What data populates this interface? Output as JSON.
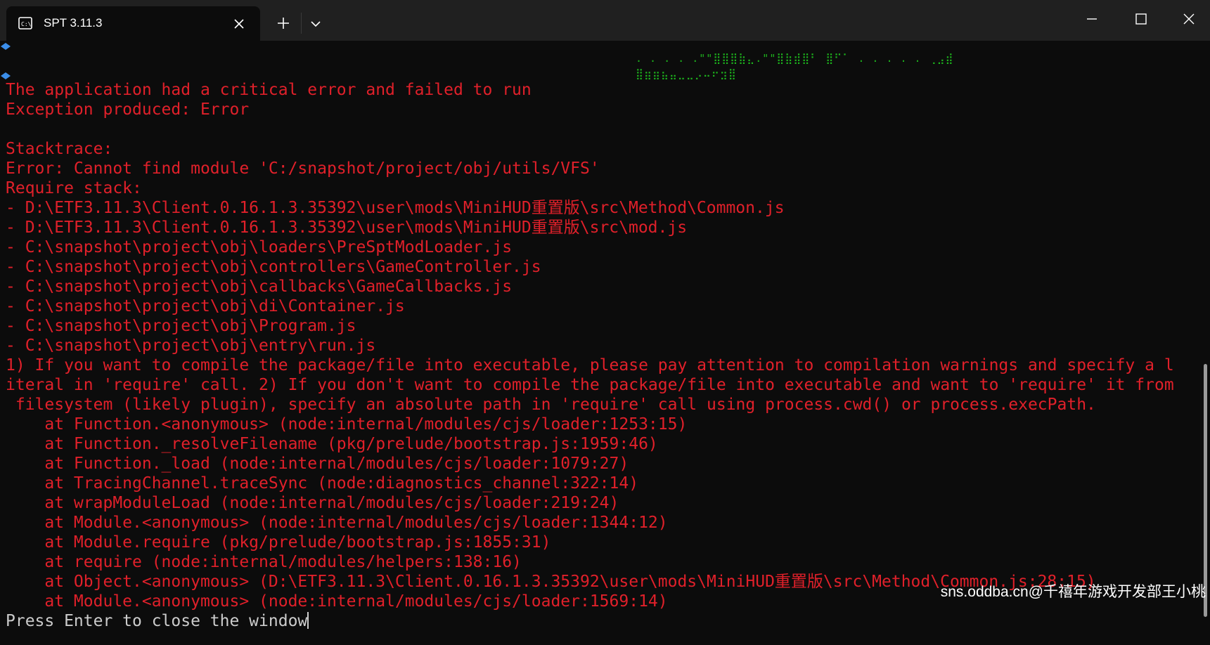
{
  "tab": {
    "title": "SPT 3.11.3",
    "icon": "terminal-icon"
  },
  "titlebar_icons": {
    "close_tab": "close-icon",
    "new_tab": "plus-icon",
    "dropdown": "chevron-down-icon",
    "minimize": "minimize-icon",
    "maximize": "maximize-icon",
    "close_window": "close-icon"
  },
  "colors": {
    "error_text": "#e0202a",
    "ascii_green": "#1db41d",
    "background": "#0c0c0c",
    "titlebar": "#202020"
  },
  "ascii_art": [
    ". . . . .\"\"⣿⣿⣿⣷⣄.\"\"⣿⣷⣾⣿⠃ ⣿⠋⠁ . . . . . ⢀⣠⣾",
    "⣿⣶⣶⣦⣤⣀⣀⡠⠤⠖⣲⣿"
  ],
  "console": {
    "lines": [
      "The application had a critical error and failed to run",
      "Exception produced: Error",
      "",
      "Stacktrace:",
      "Error: Cannot find module 'C:/snapshot/project/obj/utils/VFS'",
      "Require stack:",
      "- D:\\ETF3.11.3\\Client.0.16.1.3.35392\\user\\mods\\MiniHUD重置版\\src\\Method\\Common.js",
      "- D:\\ETF3.11.3\\Client.0.16.1.3.35392\\user\\mods\\MiniHUD重置版\\src\\mod.js",
      "- C:\\snapshot\\project\\obj\\loaders\\PreSptModLoader.js",
      "- C:\\snapshot\\project\\obj\\controllers\\GameController.js",
      "- C:\\snapshot\\project\\obj\\callbacks\\GameCallbacks.js",
      "- C:\\snapshot\\project\\obj\\di\\Container.js",
      "- C:\\snapshot\\project\\obj\\Program.js",
      "- C:\\snapshot\\project\\obj\\entry\\run.js",
      "1) If you want to compile the package/file into executable, please pay attention to compilation warnings and specify a l",
      "iteral in 'require' call. 2) If you don't want to compile the package/file into executable and want to 'require' it from",
      " filesystem (likely plugin), specify an absolute path in 'require' call using process.cwd() or process.execPath.",
      "    at Function.<anonymous> (node:internal/modules/cjs/loader:1253:15)",
      "    at Function._resolveFilename (pkg/prelude/bootstrap.js:1959:46)",
      "    at Function._load (node:internal/modules/cjs/loader:1079:27)",
      "    at TracingChannel.traceSync (node:diagnostics_channel:322:14)",
      "    at wrapModuleLoad (node:internal/modules/cjs/loader:219:24)",
      "    at Module.<anonymous> (node:internal/modules/cjs/loader:1344:12)",
      "    at Module.require (pkg/prelude/bootstrap.js:1855:31)",
      "    at require (node:internal/modules/helpers:138:16)",
      "    at Object.<anonymous> (D:\\ETF3.11.3\\Client.0.16.1.3.35392\\user\\mods\\MiniHUD重置版\\src\\Method\\Common.js:28:15)",
      "    at Module.<anonymous> (node:internal/modules/cjs/loader:1569:14)"
    ],
    "prompt": "Press Enter to close the window"
  },
  "watermark": "sns.oddba.cn@千禧年游戏开发部王小桃"
}
